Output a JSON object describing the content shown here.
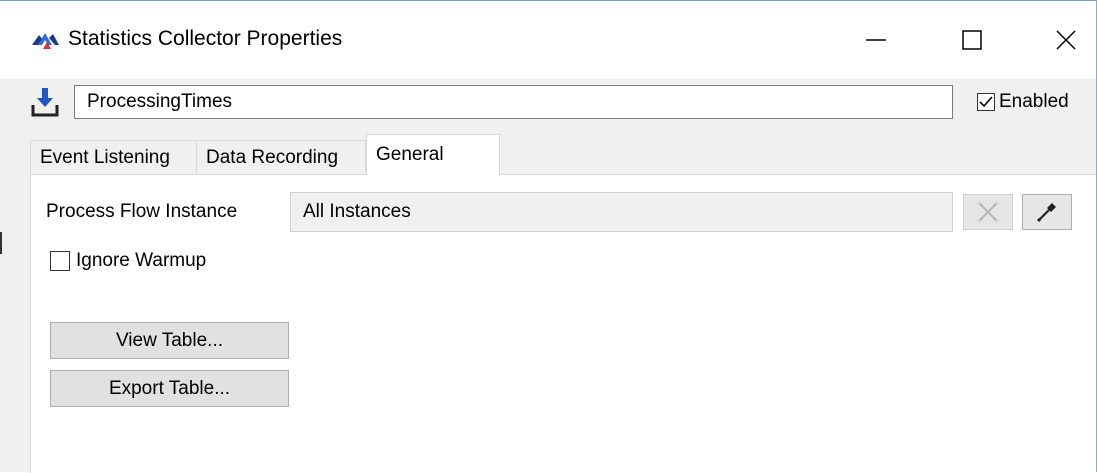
{
  "window": {
    "title": "Statistics Collector Properties",
    "app_icon": "flexsim-chevrons-icon",
    "controls": {
      "minimize": "minimize-icon",
      "maximize": "maximize-icon",
      "close": "close-icon"
    }
  },
  "header": {
    "icon": "download-arrow-icon",
    "name_value": "ProcessingTimes",
    "enabled_label": "Enabled",
    "enabled_checked": true
  },
  "tabs": [
    {
      "label": "Event Listening",
      "active": false
    },
    {
      "label": "Data Recording",
      "active": false
    },
    {
      "label": "General",
      "active": true
    }
  ],
  "general": {
    "process_flow_label": "Process Flow Instance",
    "process_flow_value": "All Instances",
    "clear_icon": "x-clear-icon",
    "picker_icon": "eyedropper-icon",
    "ignore_warmup_label": "Ignore Warmup",
    "ignore_warmup_checked": false,
    "view_table_label": "View Table...",
    "export_table_label": "Export Table..."
  },
  "colors": {
    "accent_blue": "#1f57c3",
    "window_bg": "#f0f0f0",
    "panel_bg": "#ffffff"
  }
}
